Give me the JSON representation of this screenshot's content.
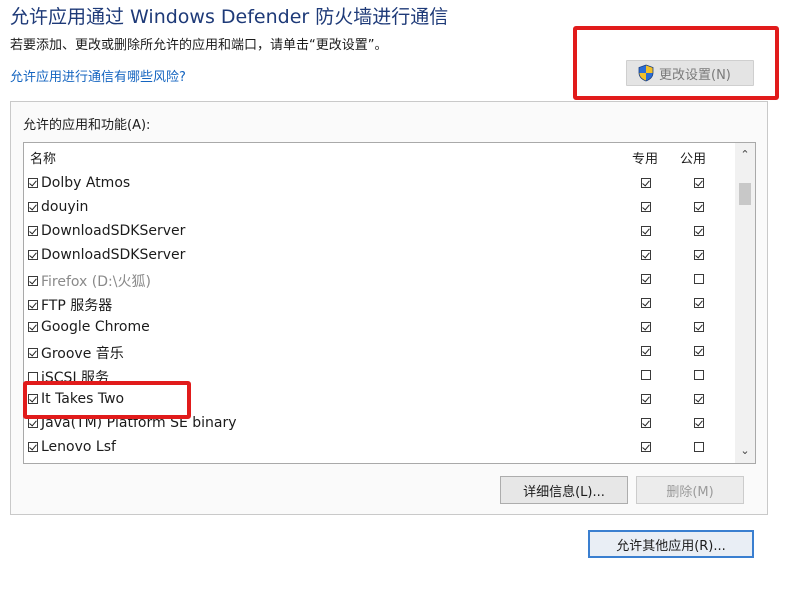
{
  "header": {
    "title": "允许应用通过 Windows Defender 防火墙进行通信",
    "subtitle": "若要添加、更改或删除所允许的应用和端口，请单击“更改设置”。",
    "risk_link": "允许应用进行通信有哪些风险?",
    "change_settings_label": "更改设置(N)"
  },
  "panel": {
    "label": "允许的应用和功能(A):",
    "columns": {
      "name": "名称",
      "private": "专用",
      "public": "公用"
    },
    "apps": [
      {
        "name": "Dolby Atmos",
        "enabled": true,
        "private": true,
        "public": true
      },
      {
        "name": "douyin",
        "enabled": true,
        "private": true,
        "public": true
      },
      {
        "name": "DownloadSDKServer",
        "enabled": true,
        "private": true,
        "public": true
      },
      {
        "name": "DownloadSDKServer",
        "enabled": true,
        "private": true,
        "public": true
      },
      {
        "name": "Firefox (D:\\火狐)",
        "enabled": true,
        "private": true,
        "public": false
      },
      {
        "name": "FTP 服务器",
        "enabled": true,
        "private": true,
        "public": true
      },
      {
        "name": "Google Chrome",
        "enabled": true,
        "private": true,
        "public": true
      },
      {
        "name": "Groove 音乐",
        "enabled": true,
        "private": true,
        "public": true
      },
      {
        "name": "iSCSI 服务",
        "enabled": false,
        "private": false,
        "public": false
      },
      {
        "name": "It Takes Two",
        "enabled": true,
        "private": true,
        "public": true
      },
      {
        "name": "Java(TM) Platform SE binary",
        "enabled": true,
        "private": true,
        "public": true
      },
      {
        "name": "Lenovo Lsf",
        "enabled": true,
        "private": true,
        "public": false
      }
    ],
    "details_label": "详细信息(L)...",
    "remove_label": "删除(M)"
  },
  "footer": {
    "allow_other_label": "允许其他应用(R)..."
  },
  "icons": {
    "shield": "uac-shield-icon",
    "scroll_up": "chevron-up-icon",
    "scroll_down": "chevron-down-icon"
  },
  "colors": {
    "title": "#1e3a78",
    "link": "#1565c0",
    "highlight": "#e11b1b",
    "focus_border": "#3a7fd0"
  }
}
